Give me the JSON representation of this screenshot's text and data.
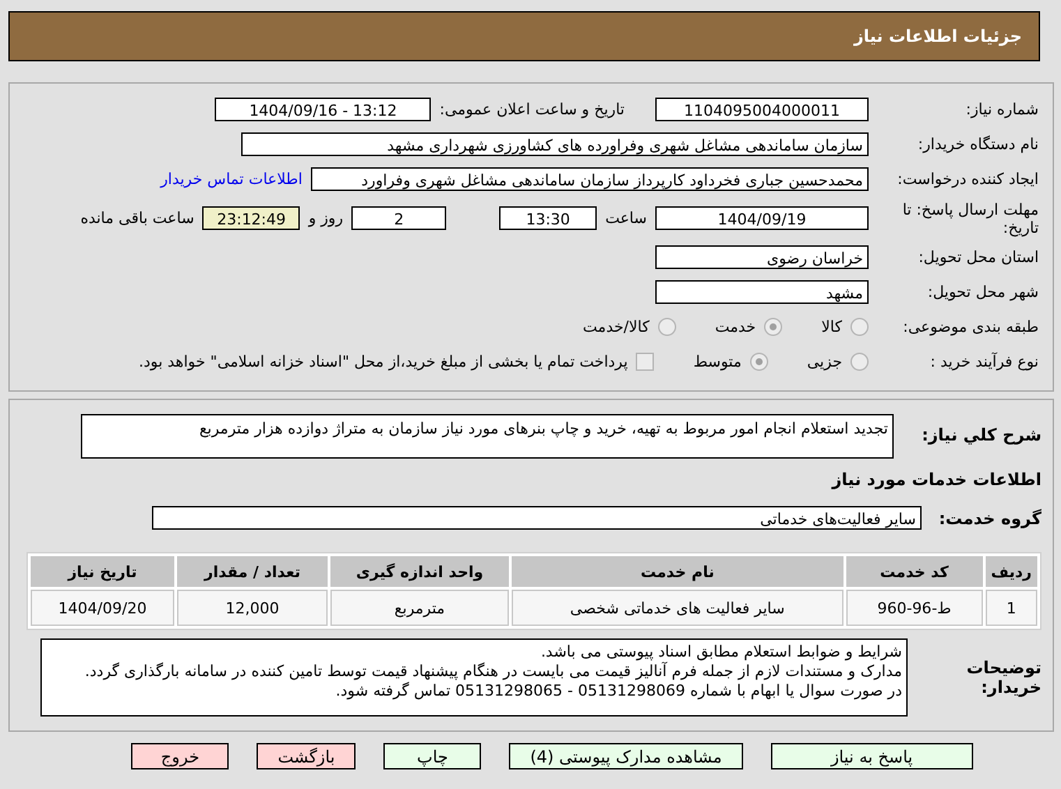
{
  "header": {
    "title": "جزئیات اطلاعات نیاز"
  },
  "need_number": {
    "label": "شماره نیاز:",
    "value": "1104095004000011"
  },
  "announce_datetime": {
    "label": "تاریخ و ساعت اعلان عمومی:",
    "value": "1404/09/16 - 13:12"
  },
  "buyer_org": {
    "label": "نام دستگاه خریدار:",
    "value": "سازمان ساماندهی مشاغل شهری وفراورده های کشاورزی شهرداری مشهد"
  },
  "requester": {
    "label": "ایجاد کننده درخواست:",
    "value": "محمدحسین جباری فخرداود کارپرداز سازمان ساماندهی مشاغل شهری وفراورد",
    "contact_link": "اطلاعات تماس خریدار"
  },
  "deadline": {
    "label": "مهلت ارسال پاسخ: تا تاریخ:",
    "date": "1404/09/19",
    "time_label": "ساعت",
    "time": "13:30",
    "days": "2",
    "days_label": "روز و",
    "remaining": "23:12:49",
    "remaining_label": "ساعت باقی مانده"
  },
  "province": {
    "label": "استان محل تحویل:",
    "value": "خراسان رضوی"
  },
  "city": {
    "label": "شهر محل تحویل:",
    "value": "مشهد"
  },
  "category": {
    "label": "طبقه بندی موضوعی:",
    "options": [
      {
        "label": "کالا",
        "selected": false
      },
      {
        "label": "خدمت",
        "selected": true
      },
      {
        "label": "کالا/خدمت",
        "selected": false
      }
    ]
  },
  "purchase_type": {
    "label": "نوع فرآیند خرید :",
    "options": [
      {
        "label": "جزیی",
        "selected": false
      },
      {
        "label": "متوسط",
        "selected": true
      }
    ],
    "payment": {
      "label": "پرداخت تمام یا بخشی از مبلغ خرید،از محل \"اسناد خزانه اسلامی\" خواهد بود.",
      "checked": false
    }
  },
  "description": {
    "label": "شرح کلي نياز:",
    "value": "تجدید استعلام انجام امور مربوط به تهیه، خرید و چاپ بنرهای مورد نیاز سازمان به متراژ دوازده هزار مترمربع"
  },
  "services_title": "اطلاعات خدمات مورد نياز",
  "service_group": {
    "label": "گروه خدمت:",
    "value": "سایر فعالیت‌های خدماتی"
  },
  "table": {
    "columns": [
      "ردیف",
      "کد خدمت",
      "نام خدمت",
      "واحد اندازه گیری",
      "تعداد / مقدار",
      "تاریخ نیاز"
    ],
    "rows": [
      [
        "1",
        "ط-96-960",
        "سایر فعالیت های خدماتی شخصی",
        "مترمربع",
        "12,000",
        "1404/09/20"
      ]
    ]
  },
  "buyer_notes": {
    "label": "توضیحات خریدار:",
    "lines": [
      "شرایط و ضوابط استعلام مطابق اسناد پیوستی می باشد.",
      "مدارک و مستندات لازم از جمله فرم آنالیز قیمت می بایست در هنگام پیشنهاد قیمت توسط تامین کننده در سامانه بارگذاری گردد.",
      "در صورت سوال یا ابهام با شماره 05131298069 - 05131298065 تماس گرفته شود."
    ]
  },
  "buttons": [
    {
      "label": "پاسخ به نیاز",
      "kind": "go"
    },
    {
      "label": "مشاهده مدارک پیوستی (4)",
      "kind": "go"
    },
    {
      "label": "چاپ",
      "kind": "go"
    },
    {
      "label": "بازگشت",
      "kind": "stop"
    },
    {
      "label": "خروج",
      "kind": "stop"
    }
  ]
}
